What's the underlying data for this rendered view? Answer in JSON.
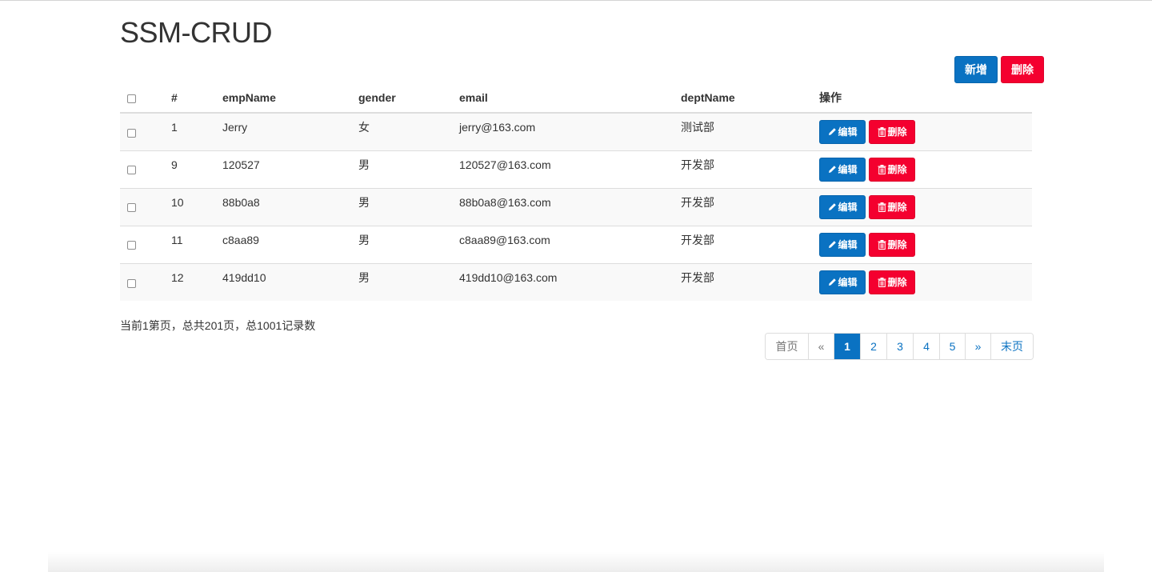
{
  "page": {
    "title": "SSM-CRUD"
  },
  "toolbar": {
    "add_label": "新增",
    "delete_label": "删除"
  },
  "table": {
    "headers": {
      "id": "#",
      "name": "empName",
      "gender": "gender",
      "email": "email",
      "dept": "deptName",
      "ops": "操作"
    },
    "rows": [
      {
        "id": "1",
        "name": "Jerry",
        "gender": "女",
        "email": "jerry@163.com",
        "dept": "测试部"
      },
      {
        "id": "9",
        "name": "120527",
        "gender": "男",
        "email": "120527@163.com",
        "dept": "开发部"
      },
      {
        "id": "10",
        "name": "88b0a8",
        "gender": "男",
        "email": "88b0a8@163.com",
        "dept": "开发部"
      },
      {
        "id": "11",
        "name": "c8aa89",
        "gender": "男",
        "email": "c8aa89@163.com",
        "dept": "开发部"
      },
      {
        "id": "12",
        "name": "419dd10",
        "gender": "男",
        "email": "419dd10@163.com",
        "dept": "开发部"
      }
    ],
    "row_actions": {
      "edit_label": "编辑",
      "delete_label": "删除",
      "edit_icon": "pencil-icon",
      "delete_icon": "trash-icon"
    }
  },
  "summary": "当前1第页，总共201页，总1001记录数",
  "pagination": {
    "first": "首页",
    "prev": "«",
    "pages": [
      "1",
      "2",
      "3",
      "4",
      "5"
    ],
    "active": "1",
    "next": "»",
    "last": "末页"
  },
  "colors": {
    "primary": "#0a72c2",
    "danger": "#f4002f"
  }
}
